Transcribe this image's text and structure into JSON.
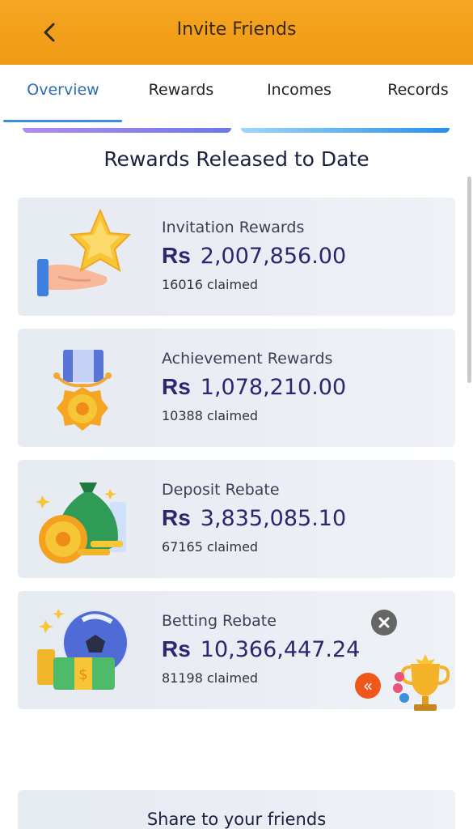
{
  "header": {
    "title": "Invite Friends",
    "back_icon": "chevron-left-icon"
  },
  "tabs": [
    {
      "label": "Overview",
      "active": true
    },
    {
      "label": "Rewards",
      "active": false
    },
    {
      "label": "Incomes",
      "active": false
    },
    {
      "label": "Records",
      "active": false
    }
  ],
  "section_title": "Rewards Released to Date",
  "cards": [
    {
      "label": "Invitation Rewards",
      "currency": "Rs",
      "amount": "2,007,856.00",
      "claimed": "16016 claimed",
      "icon": "star-hand-icon"
    },
    {
      "label": "Achievement Rewards",
      "currency": "Rs",
      "amount": "1,078,210.00",
      "claimed": "10388 claimed",
      "icon": "medal-icon"
    },
    {
      "label": "Deposit Rebate",
      "currency": "Rs",
      "amount": "3,835,085.10",
      "claimed": "67165 claimed",
      "icon": "money-bag-icon"
    },
    {
      "label": "Betting Rebate",
      "currency": "Rs",
      "amount": "10,366,447.24",
      "claimed": "81198 claimed",
      "icon": "soccer-cash-icon"
    }
  ],
  "floating": {
    "close_icon": "close-icon",
    "collapse_label": "«",
    "trophy_icon": "trophy-icon"
  },
  "share": {
    "label": "Share to your friends"
  },
  "colors": {
    "header": "#f5a623",
    "active_tab": "#2c6eb0",
    "amount": "#2c2670",
    "collapse_button": "#f0571b"
  }
}
